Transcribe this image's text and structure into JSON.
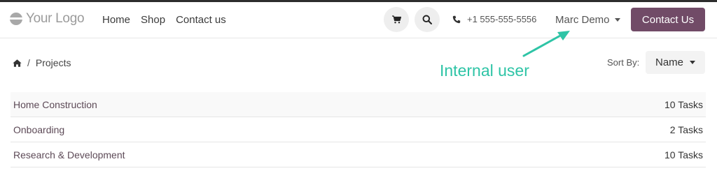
{
  "header": {
    "logo_text": "Your Logo",
    "nav": [
      "Home",
      "Shop",
      "Contact us"
    ],
    "cart_icon": "cart-icon",
    "search_icon": "search-icon",
    "phone_icon": "phone-icon",
    "phone": "+1 555-555-5556",
    "user_name": "Marc Demo",
    "contact_button": "Contact Us"
  },
  "breadcrumb": {
    "home_icon": "home-icon",
    "separator": "/",
    "current": "Projects"
  },
  "annotation": "Internal user",
  "sort": {
    "label": "Sort By:",
    "value": "Name"
  },
  "projects": [
    {
      "name": "Home Construction",
      "tasks": "10 Tasks"
    },
    {
      "name": "Onboarding",
      "tasks": "2 Tasks"
    },
    {
      "name": "Research & Development",
      "tasks": "10 Tasks"
    }
  ],
  "colors": {
    "brand": "#714b67",
    "annotation": "#2ec4a6"
  }
}
